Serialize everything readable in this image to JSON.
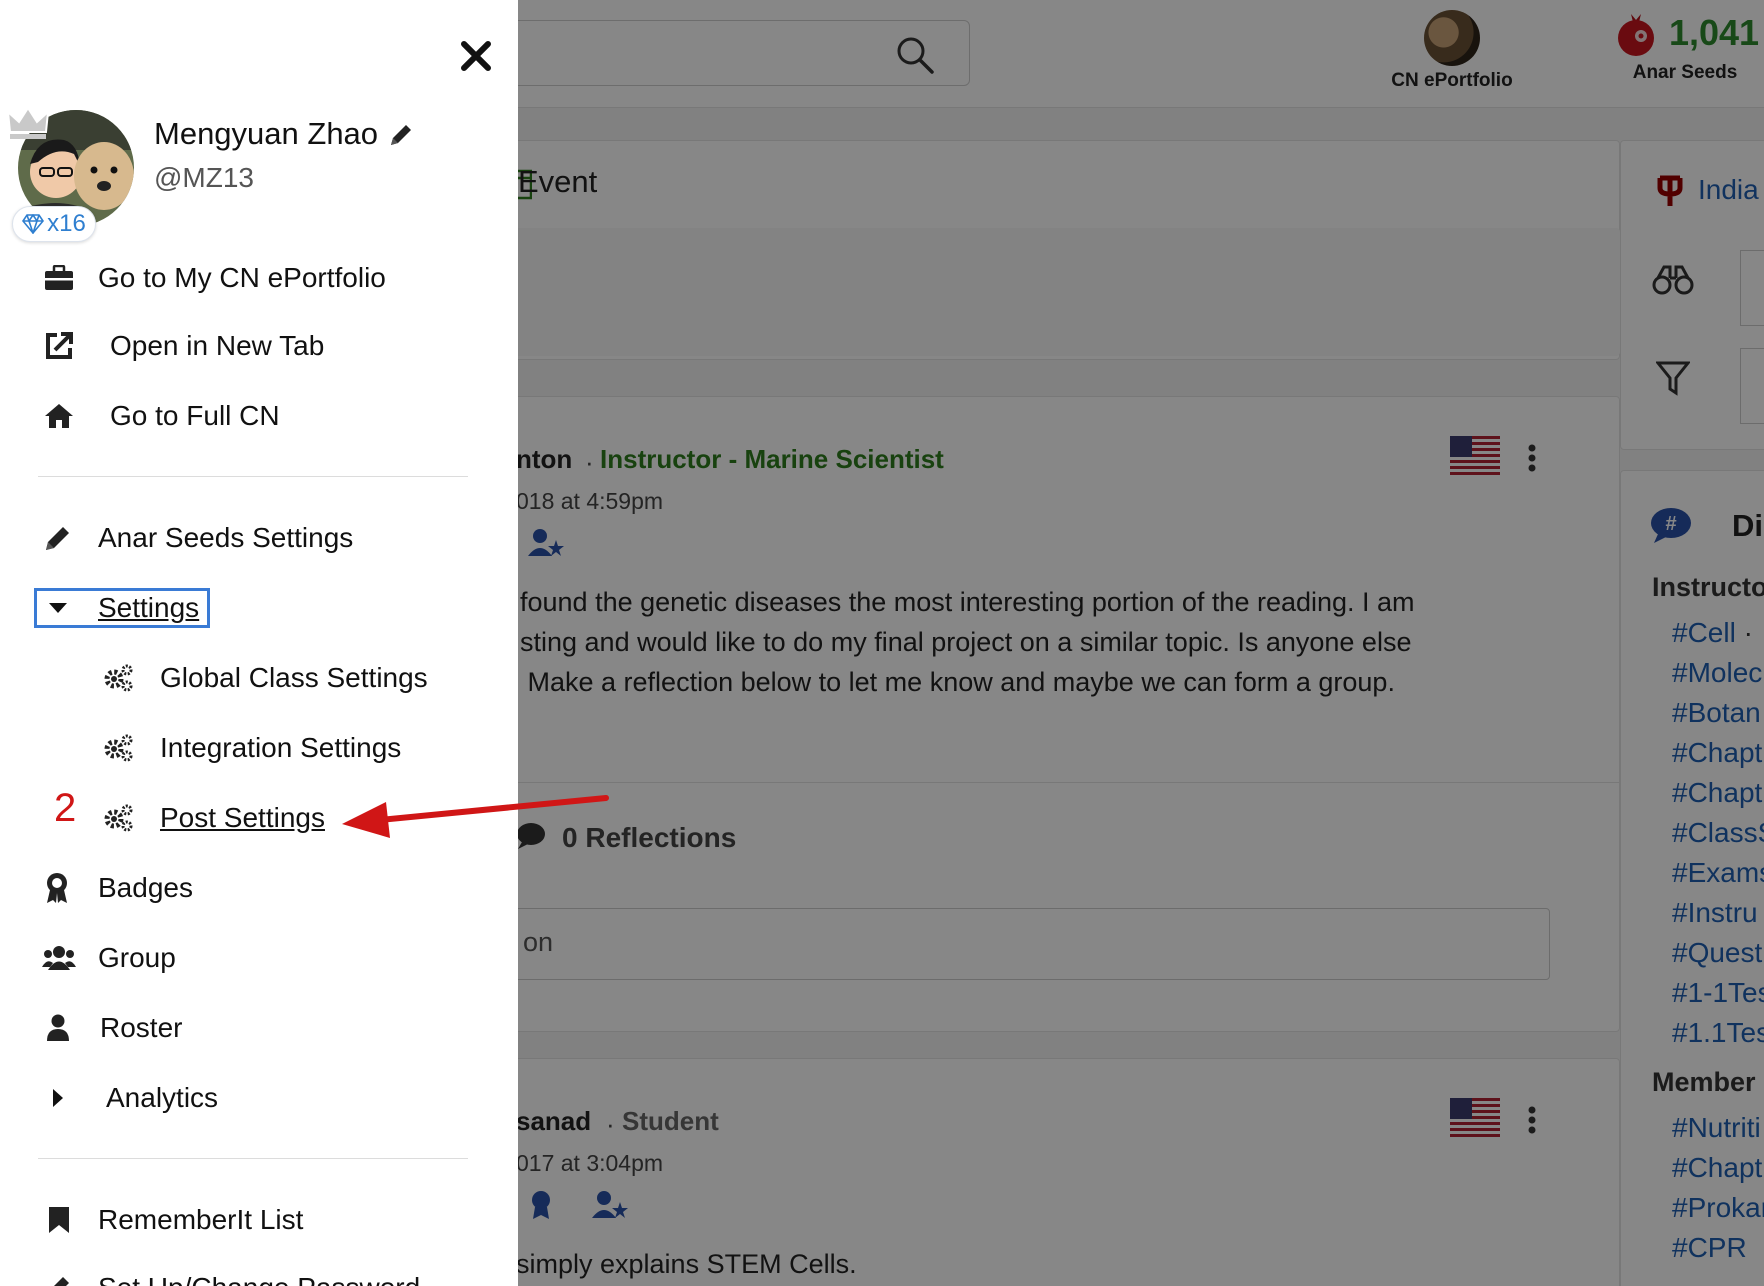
{
  "topbar": {
    "portfolio_label": "CN ePortfolio",
    "seeds_count": "1,041",
    "seeds_label": "Anar Seeds"
  },
  "feed": {
    "event_title": "Event",
    "post1": {
      "author_fragment": "nton",
      "separator": "·",
      "role": "Instructor - Marine Scientist",
      "date_fragment": "018 at 4:59pm",
      "body_lines": [
        "found the genetic diseases the most interesting portion of the reading. I am",
        "sting and would like to do my final project on a similar topic. Is anyone else",
        " Make a reflection below to let me know and maybe we can form a group."
      ]
    },
    "reflections": "0 Reflections",
    "reply_placeholder_fragment": "on",
    "post2": {
      "author_fragment": "sanad",
      "separator": "·",
      "role": "Student",
      "date_fragment": "017 at 3:04pm",
      "body_fragment": "simply explains STEM Cells."
    }
  },
  "right_panel": {
    "school_fragment": "India",
    "discuss_fragment": "Di",
    "instructor_heading": "Instructo",
    "instructor_tags": [
      "#Cell",
      "#Molec",
      "#Botan",
      "#Chapt",
      "#Chapt",
      "#ClassS",
      "#Exams",
      "#Instru",
      "#Quest",
      "#1-1Tes",
      "#1.1Tes"
    ],
    "member_heading": "Member",
    "member_tags": [
      "#Nutriti",
      "#Chapt",
      "#Prokar",
      "#CPR"
    ],
    "cell_suffix": "·"
  },
  "drawer": {
    "user_name": "Mengyuan Zhao",
    "user_handle": "@MZ13",
    "gem_count": "x16",
    "items": {
      "eportfolio": "Go to My CN ePortfolio",
      "new_tab": "Open in New Tab",
      "full_cn": "Go to Full CN",
      "anar_seeds_settings": "Anar Seeds Settings",
      "settings": "Settings",
      "global_class_settings": "Global Class Settings",
      "integration_settings": "Integration Settings",
      "post_settings": "Post Settings",
      "badges": "Badges",
      "group": "Group",
      "roster": "Roster",
      "analytics": "Analytics",
      "rememberit_list": "RememberIt List",
      "set_password": "Set Up/Change Password"
    },
    "annotation_step": "2"
  },
  "colors": {
    "link_blue": "#1f5fb2",
    "seeds_green": "#2f8a2f",
    "role_green": "#2e7d1e",
    "annotation_red": "#d01616",
    "focus_blue": "#3a7bd5"
  }
}
